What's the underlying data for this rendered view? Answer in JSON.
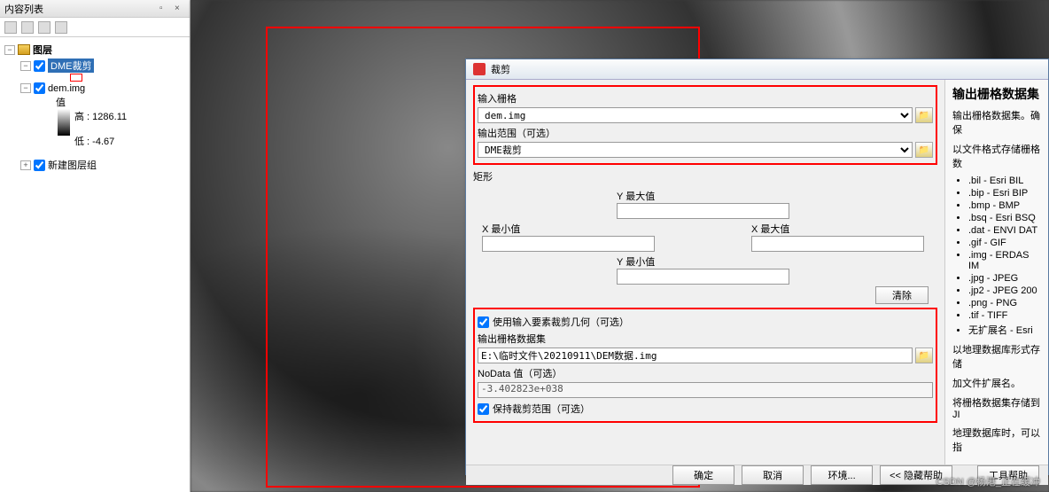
{
  "toc": {
    "title": "内容列表",
    "root": "图层",
    "layer1": "DME裁剪",
    "layer2": "dem.img",
    "value_label": "值",
    "high": "高 : 1286.11",
    "low": "低 : -4.67",
    "layer3": "新建图层组"
  },
  "map": {
    "annotation_box": true
  },
  "dialog": {
    "title": "裁剪",
    "fields": {
      "input_raster_label": "输入栅格",
      "input_raster_value": "dem.img",
      "output_extent_label": "输出范围（可选）",
      "output_extent_value": "DME裁剪",
      "rect_label": "矩形",
      "y_max": "Y 最大值",
      "x_min": "X 最小值",
      "x_max": "X 最大值",
      "y_min": "Y 最小值",
      "clear": "清除",
      "use_features_label": "使用输入要素裁剪几何（可选）",
      "output_dataset_label": "输出栅格数据集",
      "output_dataset_value": "E:\\临时文件\\20210911\\DEM数据.img",
      "nodata_label": "NoData 值（可选）",
      "nodata_value": "-3.402823e+038",
      "keep_extent_label": "保持裁剪范围（可选）"
    },
    "buttons": {
      "ok": "确定",
      "cancel": "取消",
      "env": "环境...",
      "hide_help": "<< 隐藏帮助",
      "tool_help": "工具帮助"
    },
    "help": {
      "title": "输出栅格数据集",
      "p1": "输出栅格数据集。确保",
      "p2": "以文件格式存储栅格数",
      "formats": [
        ".bil - Esri BIL",
        ".bip - Esri BIP",
        ".bmp - BMP",
        ".bsq - Esri BSQ",
        ".dat - ENVI DAT",
        ".gif - GIF",
        ".img - ERDAS IM",
        ".jpg - JPEG",
        ".jp2 - JPEG 200",
        ".png - PNG",
        ".tif - TIFF",
        "无扩展名 - Esri"
      ],
      "p3": "以地理数据库形式存储",
      "p4": "加文件扩展名。",
      "p5": "将栅格数据集存储到 JI",
      "p6": "地理数据库时，可以指"
    }
  },
  "watermark": "CSDN @杨港_正在缓冲"
}
